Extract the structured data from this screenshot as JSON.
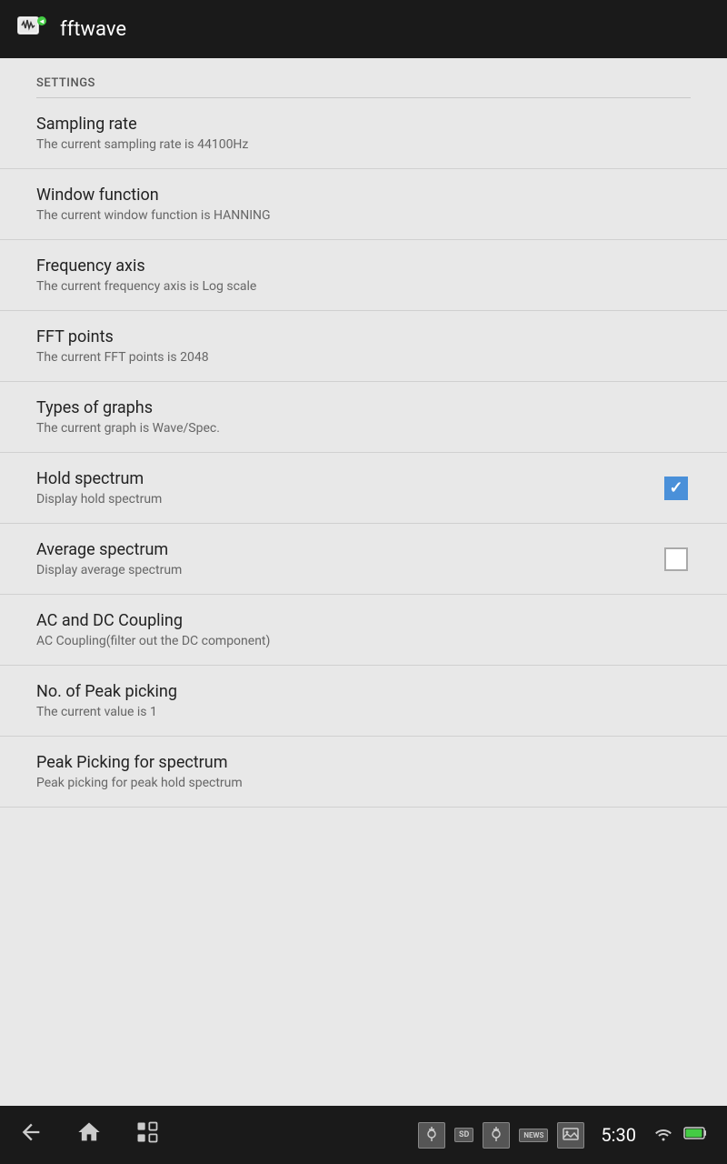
{
  "app": {
    "title": "fftwave"
  },
  "settings": {
    "header_label": "SETTINGS",
    "items": [
      {
        "id": "sampling-rate",
        "title": "Sampling rate",
        "subtitle": "The current sampling rate is 44100Hz",
        "has_checkbox": false,
        "checked": null
      },
      {
        "id": "window-function",
        "title": "Window function",
        "subtitle": "The current window function is HANNING",
        "has_checkbox": false,
        "checked": null
      },
      {
        "id": "frequency-axis",
        "title": "Frequency axis",
        "subtitle": "The current frequency axis is Log scale",
        "has_checkbox": false,
        "checked": null
      },
      {
        "id": "fft-points",
        "title": "FFT points",
        "subtitle": "The current FFT points is 2048",
        "has_checkbox": false,
        "checked": null
      },
      {
        "id": "types-of-graphs",
        "title": "Types of graphs",
        "subtitle": "The current graph is Wave/Spec.",
        "has_checkbox": false,
        "checked": null
      },
      {
        "id": "hold-spectrum",
        "title": "Hold spectrum",
        "subtitle": "Display hold spectrum",
        "has_checkbox": true,
        "checked": true
      },
      {
        "id": "average-spectrum",
        "title": "Average spectrum",
        "subtitle": "Display average spectrum",
        "has_checkbox": true,
        "checked": false
      },
      {
        "id": "ac-dc-coupling",
        "title": "AC and DC Coupling",
        "subtitle": "AC Coupling(filter out the DC component)",
        "has_checkbox": false,
        "checked": null
      },
      {
        "id": "peak-picking-no",
        "title": "No. of Peak picking",
        "subtitle": "The current value is 1",
        "has_checkbox": false,
        "checked": null
      },
      {
        "id": "peak-picking-spectrum",
        "title": "Peak Picking for spectrum",
        "subtitle": "Peak picking for peak hold spectrum",
        "has_checkbox": false,
        "checked": null
      }
    ]
  },
  "navbar": {
    "time": "5:30",
    "back_label": "back",
    "home_label": "home",
    "recents_label": "recents"
  },
  "colors": {
    "topbar_bg": "#1a1a1a",
    "content_bg": "#e8e8e8",
    "checkbox_checked": "#4a90d9",
    "divider": "#d0d0d0"
  }
}
